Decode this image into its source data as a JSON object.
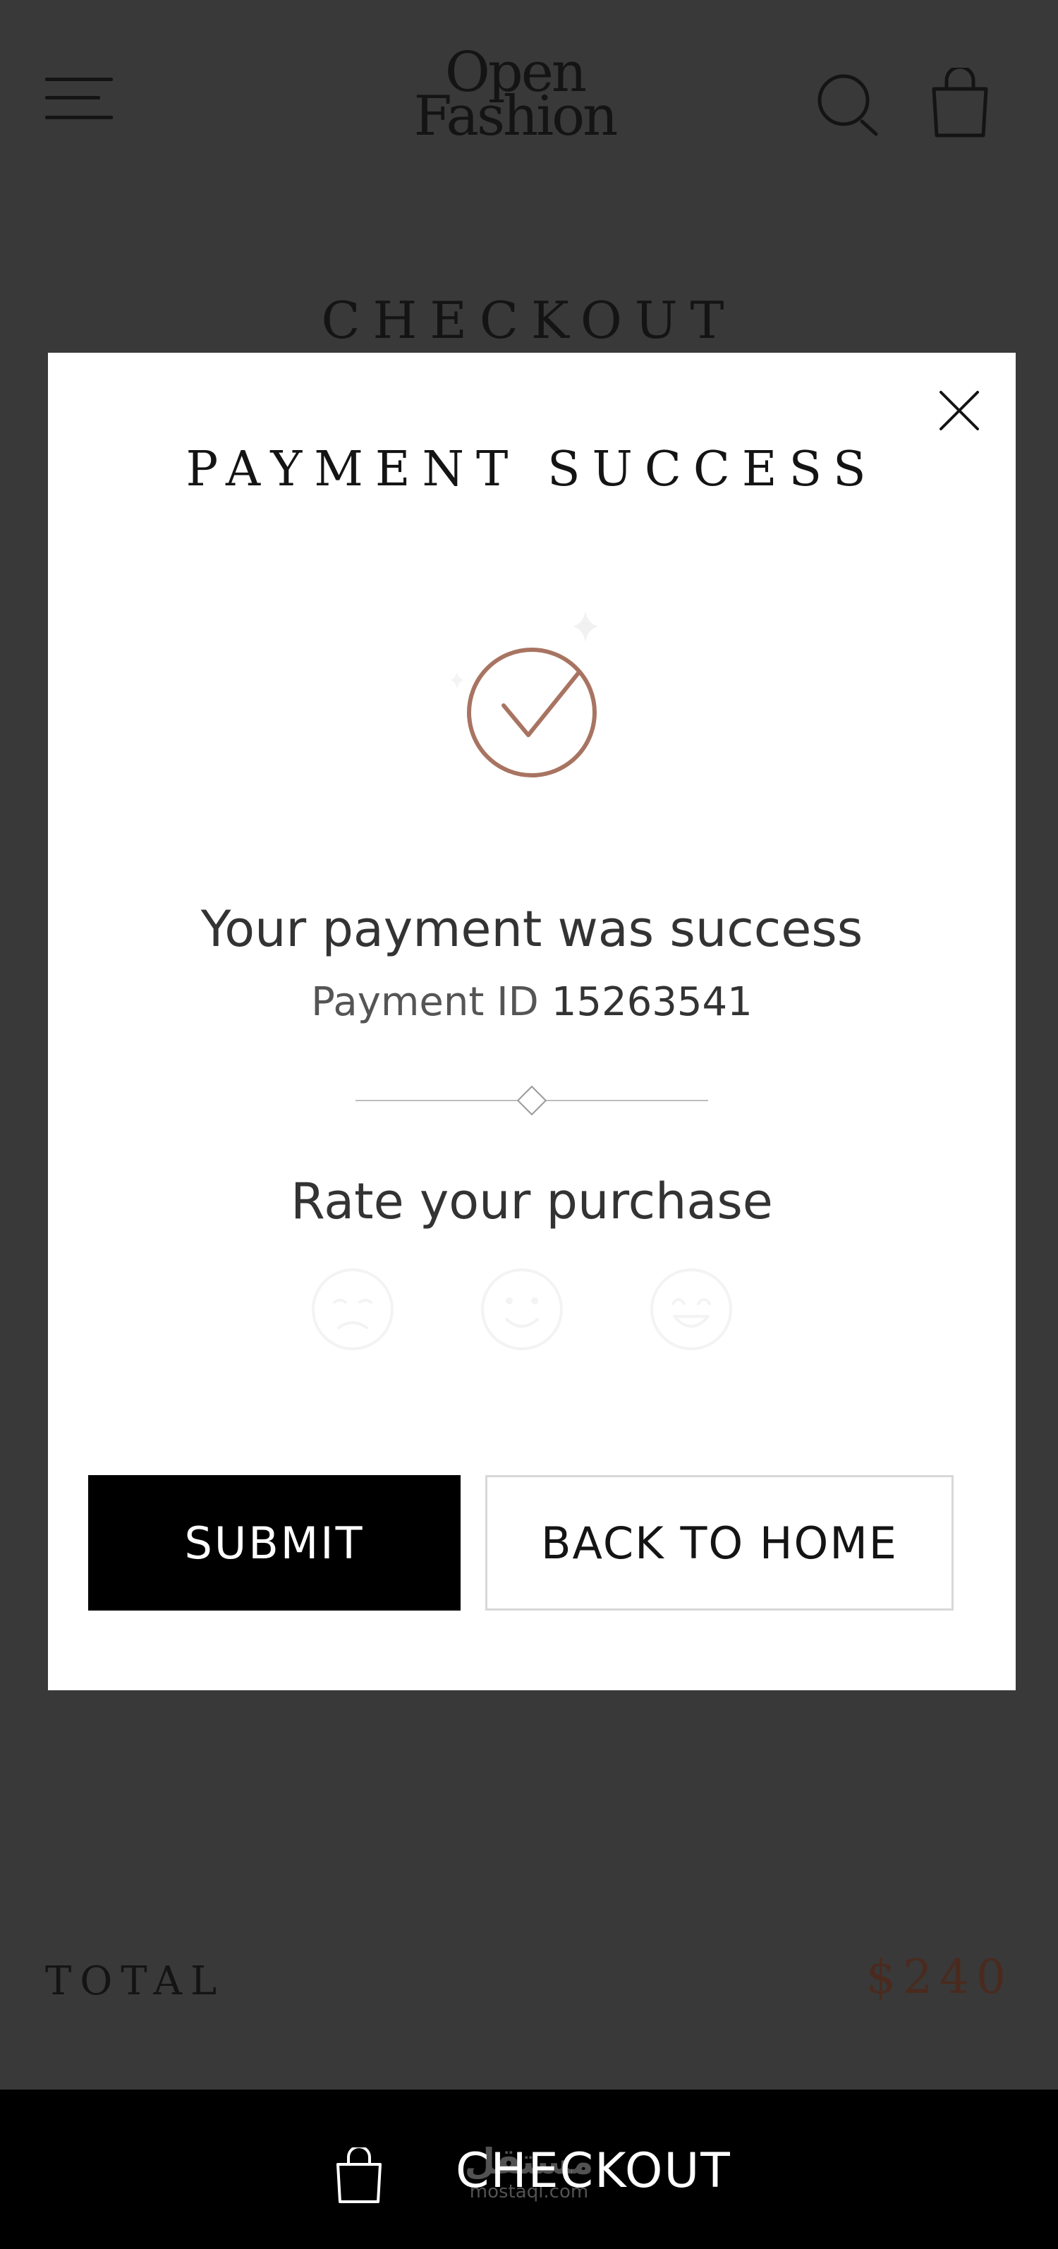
{
  "header": {
    "logo_line1": "Open",
    "logo_line2": "Fashion",
    "menu_icon": "menu-icon",
    "search_icon": "search-icon",
    "bag_icon": "shopping-bag-icon"
  },
  "page": {
    "title": "CHECKOUT"
  },
  "modal": {
    "title": "PAYMENT SUCCESS",
    "close_icon": "close-icon",
    "success_icon": "check-circle-icon",
    "accent_color": "#a87462",
    "message": "Your payment was success",
    "payment_id_label": "Payment ID",
    "payment_id_value": "15263541",
    "rate_title": "Rate your purchase",
    "rating_options": [
      "unhappy-face-icon",
      "smile-face-icon",
      "love-face-icon"
    ],
    "submit_label": "SUBMIT",
    "back_home_label": "BACK TO HOME"
  },
  "summary": {
    "total_label": "TOTAL",
    "total_value": "$240"
  },
  "bottom_bar": {
    "icon": "shopping-bag-icon",
    "label": "CHECKOUT",
    "watermark_line1": "مستقل",
    "watermark_line2": "mostaql.com"
  }
}
